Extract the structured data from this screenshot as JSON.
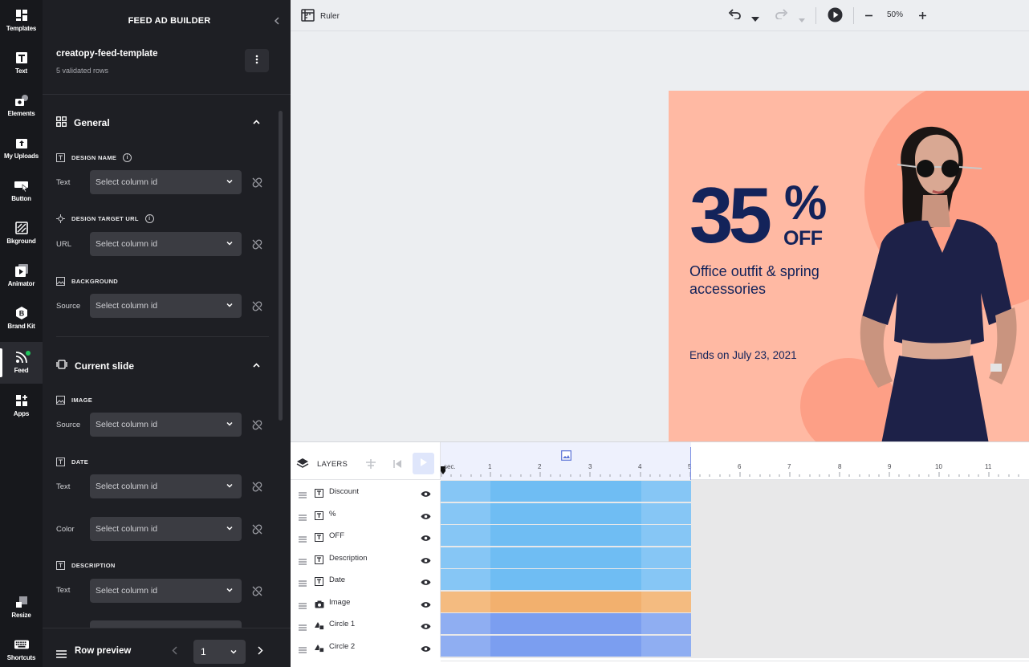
{
  "rail": [
    {
      "label": "Templates",
      "icon": "templates-icon"
    },
    {
      "label": "Text",
      "icon": "text-icon"
    },
    {
      "label": "Elements",
      "icon": "elements-icon"
    },
    {
      "label": "My Uploads",
      "icon": "uploads-icon"
    },
    {
      "label": "Button",
      "icon": "button-icon"
    },
    {
      "label": "Bkground",
      "icon": "background-icon"
    },
    {
      "label": "Animator",
      "icon": "animator-icon"
    },
    {
      "label": "Brand Kit",
      "icon": "brand-kit-icon"
    },
    {
      "label": "Feed",
      "icon": "feed-icon"
    },
    {
      "label": "Apps",
      "icon": "apps-icon"
    },
    {
      "label": "Resize",
      "icon": "resize-icon"
    },
    {
      "label": "Shortcuts",
      "icon": "keyboard-icon"
    }
  ],
  "panel": {
    "title": "FEED AD BUILDER",
    "template_name": "creatopy-feed-template",
    "rows_status": "5 validated rows",
    "general": {
      "title": "General",
      "design_name": {
        "heading": "DESIGN NAME",
        "label": "Text",
        "placeholder": "Select column id"
      },
      "design_target_url": {
        "heading": "DESIGN TARGET URL",
        "label": "URL",
        "placeholder": "Select column id"
      },
      "background": {
        "heading": "BACKGROUND",
        "label": "Source",
        "placeholder": "Select column id"
      }
    },
    "current_slide": {
      "title": "Current slide",
      "image": {
        "heading": "IMAGE",
        "label": "Source",
        "placeholder": "Select column id"
      },
      "date": {
        "heading": "DATE",
        "text_label": "Text",
        "color_label": "Color",
        "placeholder": "Select column id"
      },
      "description": {
        "heading": "DESCRIPTION",
        "label": "Text",
        "placeholder": "Select column id"
      }
    },
    "row_preview": {
      "label": "Row preview",
      "value": "1"
    }
  },
  "topbar": {
    "ruler_label": "Ruler",
    "zoom": "50%"
  },
  "ad": {
    "discount": "35",
    "percent": "%",
    "off": "OFF",
    "description": "Office outfit & spring accessories",
    "date": "Ends on July 23, 2021",
    "background_color": "#ffb9a3",
    "circle_color": "#fd9f86",
    "text_color": "#13235a"
  },
  "timeline": {
    "layers_title": "LAYERS",
    "sec_label": "sec.",
    "ticks": [
      "1",
      "2",
      "3",
      "4",
      "5",
      "6",
      "7",
      "8",
      "9",
      "10",
      "11"
    ],
    "layers": [
      {
        "name": "Discount",
        "type": "text",
        "color": "#6fbdf3"
      },
      {
        "name": "%",
        "type": "text",
        "color": "#6fbdf3"
      },
      {
        "name": "OFF",
        "type": "text",
        "color": "#6fbdf3"
      },
      {
        "name": "Description",
        "type": "text",
        "color": "#6fbdf3"
      },
      {
        "name": "Date",
        "type": "text",
        "color": "#6fbdf3"
      },
      {
        "name": "Image",
        "type": "image",
        "color": "#f2b06e"
      },
      {
        "name": "Circle 1",
        "type": "shape",
        "color": "#7b9ef0"
      },
      {
        "name": "Circle 2",
        "type": "shape",
        "color": "#7b9ef0"
      }
    ]
  }
}
